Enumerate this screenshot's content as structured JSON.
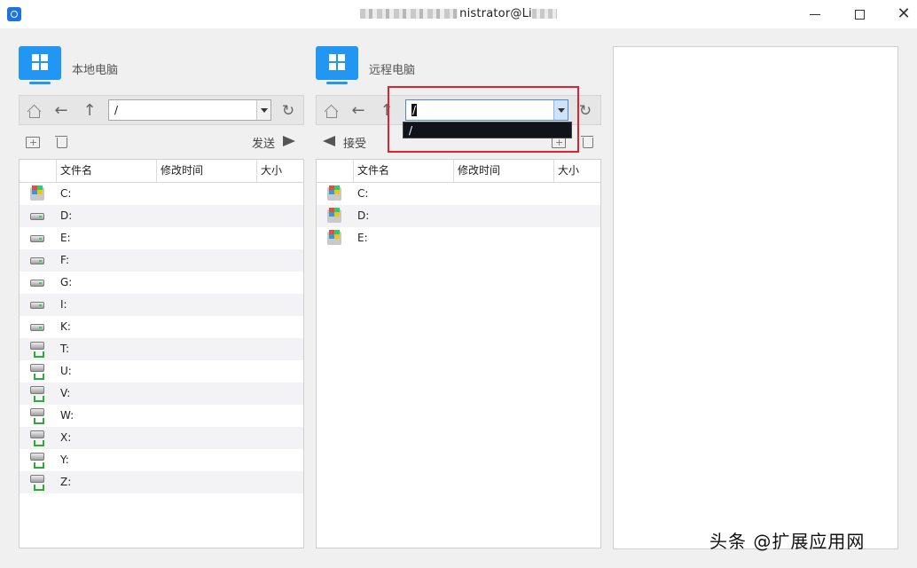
{
  "window": {
    "title": "nistrator@Li",
    "controls": {
      "minimize": "—",
      "maximize": "☐",
      "close": "✕"
    }
  },
  "local": {
    "label": "本地电脑",
    "path": "/",
    "send_label": "发送",
    "columns": [
      "",
      "文件名",
      "修改时间",
      "大小"
    ],
    "items": [
      {
        "name": "C:",
        "icon": "system-drive-icon"
      },
      {
        "name": "D:",
        "icon": "disk-drive-icon"
      },
      {
        "name": "E:",
        "icon": "disk-drive-icon"
      },
      {
        "name": "F:",
        "icon": "disk-drive-icon"
      },
      {
        "name": "G:",
        "icon": "disk-drive-icon"
      },
      {
        "name": "I:",
        "icon": "disk-drive-icon"
      },
      {
        "name": "K:",
        "icon": "disk-drive-icon"
      },
      {
        "name": "T:",
        "icon": "network-drive-icon"
      },
      {
        "name": "U:",
        "icon": "network-drive-icon"
      },
      {
        "name": "V:",
        "icon": "network-drive-icon"
      },
      {
        "name": "W:",
        "icon": "network-drive-icon"
      },
      {
        "name": "X:",
        "icon": "network-drive-icon"
      },
      {
        "name": "Y:",
        "icon": "network-drive-icon"
      },
      {
        "name": "Z:",
        "icon": "network-drive-icon"
      }
    ]
  },
  "remote": {
    "label": "远程电脑",
    "path": "/",
    "receive_label": "接受",
    "dropdown_options": [
      "/"
    ],
    "columns": [
      "",
      "文件名",
      "修改时间",
      "大小"
    ],
    "items": [
      {
        "name": "C:",
        "icon": "system-drive-icon"
      },
      {
        "name": "D:",
        "icon": "system-drive-icon"
      },
      {
        "name": "E:",
        "icon": "system-drive-icon"
      }
    ]
  },
  "watermark": "头条 @扩展应用网",
  "colors": {
    "accent": "#2196f3",
    "highlight": "#e0232e"
  }
}
